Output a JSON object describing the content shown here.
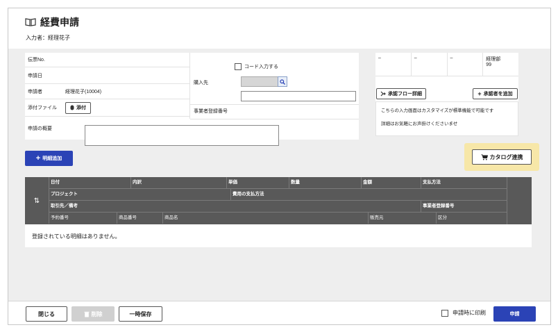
{
  "header": {
    "title": "経費申請",
    "entrant_label": "入力者：経理花子"
  },
  "form": {
    "voucher_label": "伝票No.",
    "date_label": "申請日",
    "applicant_label": "申請者",
    "applicant_value": "経理花子(10004)",
    "attachment_label": "添付ファイル",
    "attach_button": "添付",
    "summary_label": "申請の概要",
    "code_input_label": "コード入力する",
    "vendor_label": "購入先",
    "business_reg_label": "事業者登録番号"
  },
  "approvers": [
    {
      "line1": "–",
      "line2": ""
    },
    {
      "line1": "–",
      "line2": ""
    },
    {
      "line1": "–",
      "line2": ""
    },
    {
      "line1": "経理部",
      "line2": "99"
    }
  ],
  "approval_flow_button": "承認フロー詳細",
  "add_approver_button": "承認者を追加",
  "note": {
    "line1": "こちらの入力画面はカスタマイズが標準機能で可能です",
    "line2": "詳細はお気軽にお声掛けくださいませ"
  },
  "add_detail_button": "明細追加",
  "catalog_button": "カタログ連携",
  "table": {
    "row1": [
      "日付",
      "内訳",
      "単価",
      "数量",
      "金額",
      "支払方法"
    ],
    "row2": [
      "プロジェクト",
      "費用の支払方法"
    ],
    "row3": [
      "取引先／備考",
      "事業者登録番号"
    ],
    "row4": [
      "予約番号",
      "商品番号",
      "商品名",
      "販売元",
      "区分"
    ],
    "empty_message": "登録されている明細はありません。"
  },
  "footer": {
    "close_button": "閉じる",
    "delete_button": "削除",
    "save_button": "一時保存",
    "print_label": "申請時に印刷",
    "submit_button": "申請"
  },
  "colors": {
    "accent": "#2b43b6",
    "header_dark": "#595959",
    "highlight": "#f7e7a8"
  }
}
